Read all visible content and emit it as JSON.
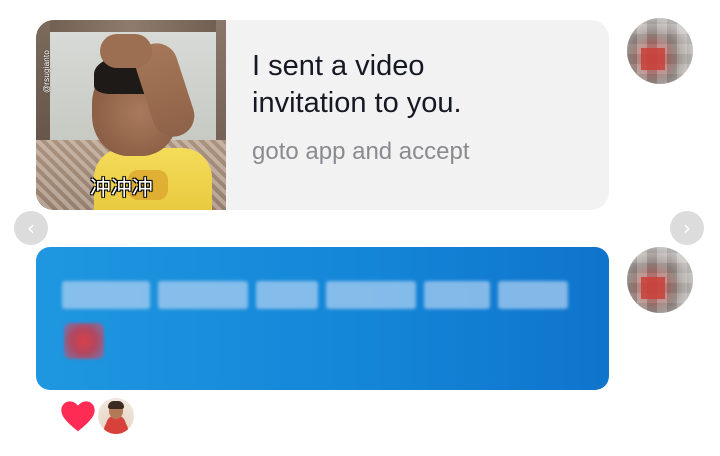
{
  "invite": {
    "title": "I sent a video invitation to you.",
    "subtitle": "goto app and accept",
    "thumbnail": {
      "watermark": "@rsugianto",
      "caption": "冲冲冲"
    }
  },
  "nav": {
    "prev_glyph": "‹",
    "next_glyph": "›"
  },
  "icons": {
    "reaction": "heart-icon",
    "prev": "chevron-left-icon",
    "next": "chevron-right-icon"
  },
  "colors": {
    "bubble_blue": "#1487d8",
    "card_bg": "#f2f2f2",
    "heart": "#fe2c55",
    "subtitle_gray": "#8a8b91"
  }
}
